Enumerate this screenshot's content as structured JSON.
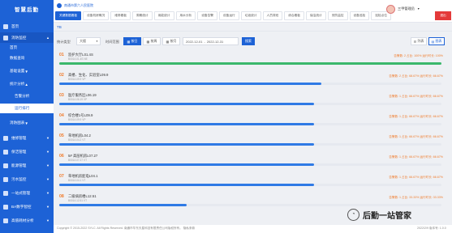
{
  "sidebar": {
    "logo": "智慧后勤",
    "items": [
      {
        "label": "首页"
      },
      {
        "label": "消防监控"
      },
      {
        "label": "首页"
      },
      {
        "label": "数据查询"
      },
      {
        "label": "基础设置"
      },
      {
        "label": "统计分析"
      },
      {
        "label": "告警分析"
      },
      {
        "label": "运行排行"
      },
      {
        "label": "消防图表"
      },
      {
        "label": "维修管理"
      },
      {
        "label": "保洁管理"
      },
      {
        "label": "能源管理"
      },
      {
        "label": "污水监控"
      },
      {
        "label": "一站式管理"
      },
      {
        "label": "BA数字智控"
      },
      {
        "label": "高值耗材分析"
      }
    ]
  },
  "topbar": {
    "brand": "南通市第六人民医院",
    "tabs": [
      {
        "label": "关键数据看板"
      },
      {
        "label": "设备机房概况"
      },
      {
        "label": "维修看板"
      },
      {
        "label": "周期统计"
      },
      {
        "label": "用能统计"
      },
      {
        "label": "用水分析"
      },
      {
        "label": "设备告警"
      },
      {
        "label": "设备运行"
      },
      {
        "label": "垃圾统计"
      },
      {
        "label": "人员排班"
      },
      {
        "label": "综合看板"
      },
      {
        "label": "保洁统计"
      },
      {
        "label": "安防监控"
      },
      {
        "label": "设备巡检"
      },
      {
        "label": "巡检点位"
      }
    ],
    "user_name": "三甲管理员",
    "action": "退出"
  },
  "page": {
    "subtab": "TB",
    "filters": {
      "type_label": "统计类型",
      "type_value": "大楼",
      "period_label": "时间范围",
      "periods": [
        {
          "label": "按日",
          "active": true
        },
        {
          "label": "按周",
          "active": false
        },
        {
          "label": "按月",
          "active": false
        }
      ],
      "date_start": "2022-12-01",
      "date_sep": "-",
      "date_end": "2022-12-31",
      "search": "搜索",
      "view_list": "列表",
      "view_chart": "图表"
    },
    "rows": [
      {
        "rank": "01",
        "title": "监护大厅L01.4S",
        "meta": "B001/L01.4S  NE",
        "stats": "告警数: 2  占比: 100%  运行时长: 100%",
        "percent": 100,
        "color": "#3bb86c"
      },
      {
        "rank": "02",
        "title": "高楼、生化、实验室L09.9",
        "meta": "B001/L09.9  VP",
        "stats": "告警数: 2  占比: 68.67%  运行时长: 66.67%",
        "percent": 68.67,
        "color": "#2f7ae5"
      },
      {
        "rank": "03",
        "title": "医疗服务区L06.19",
        "meta": "B001/L06.19  VP",
        "stats": "告警数: 1  占比: 66.67%  运行时长: 66.67%",
        "percent": 66.67,
        "color": "#2f7ae5"
      },
      {
        "rank": "04",
        "title": "综合楼1号L09.9",
        "meta": "B001/L09.9  VP",
        "stats": "告警数: 1  占比: 66.67%  运行时长: 66.67%",
        "percent": 66.67,
        "color": "#2f7ae5"
      },
      {
        "rank": "05",
        "title": "草地机房L04.2",
        "meta": "B001/L04.2  VT",
        "stats": "告警数: 1  占比: 66.67%  运行时长: 66.67%",
        "percent": 66.67,
        "color": "#2f7ae5"
      },
      {
        "rank": "06",
        "title": "5# 高层机房L07.27",
        "meta": "B001/L07.27  VT",
        "stats": "告警数: 1  占比: 66.67%  运行时长: 66.67%",
        "percent": 66.67,
        "color": "#2f7ae5"
      },
      {
        "rank": "07",
        "title": "草地机房配电L04.1",
        "meta": "B001/L04.1  VT",
        "stats": "告警数: 1  占比: 66.67%  运行时长: 66.67%",
        "percent": 66.67,
        "color": "#2f7ae5"
      },
      {
        "rank": "08",
        "title": "二级病房楼L12.51",
        "meta": "B001/L12.51  VT",
        "stats": "告警数: 1  占比: 33.33%  运行时长: 33.33%",
        "percent": 33.33,
        "color": "#2f7ae5"
      }
    ]
  },
  "footer": {
    "copyright": "Copyright © 2015-2022 SYLC. All Rights Reserved. 南通市华东天星科技有限责任公司版权所有。  隐私条款",
    "version": "2022/2/9 版本号: 1.0.0"
  },
  "watermark": "后勤一站管家"
}
